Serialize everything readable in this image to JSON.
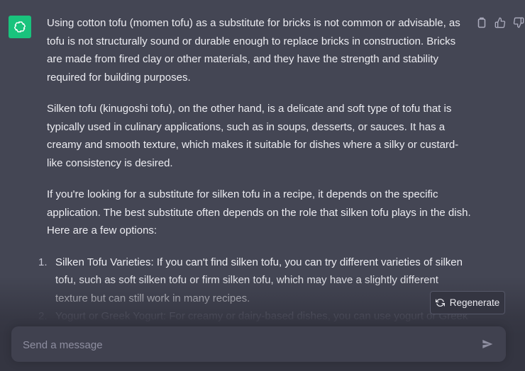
{
  "assistant": {
    "avatar_icon": "openai-logo-icon",
    "avatar_color": "#19c37d"
  },
  "message_actions": [
    "copy-icon",
    "thumbs-up-icon",
    "thumbs-down-icon"
  ],
  "message": {
    "paragraphs": [
      "Using cotton tofu (momen tofu) as a substitute for bricks is not common or advisable, as tofu is not structurally sound or durable enough to replace bricks in construction. Bricks are made from fired clay or other materials, and they have the strength and stability required for building purposes.",
      "Silken tofu (kinugoshi tofu), on the other hand, is a delicate and soft type of tofu that is typically used in culinary applications, such as in soups, desserts, or sauces. It has a creamy and smooth texture, which makes it suitable for dishes where a silky or custard-like consistency is desired.",
      "If you're looking for a substitute for silken tofu in a recipe, it depends on the specific application. The best substitute often depends on the role that silken tofu plays in the dish. Here are a few options:"
    ],
    "list": [
      {
        "num": "1.",
        "text": "Silken Tofu Varieties: If you can't find silken tofu, you can try different varieties of silken tofu, such as soft silken tofu or firm silken tofu, which may have a slightly different texture but can still work in many recipes."
      },
      {
        "num": "2.",
        "text": "Yogurt or Greek Yogurt: For creamy or dairy-based dishes, you can use yogurt or Greek"
      }
    ]
  },
  "regenerate": {
    "label": "Regenerate",
    "icon": "refresh-icon"
  },
  "composer": {
    "placeholder": "Send a message",
    "value": "",
    "send_icon": "send-icon"
  },
  "colors": {
    "background": "#444654",
    "text": "#ececf1",
    "composer_bg": "#40414f",
    "accent": "#19c37d"
  }
}
